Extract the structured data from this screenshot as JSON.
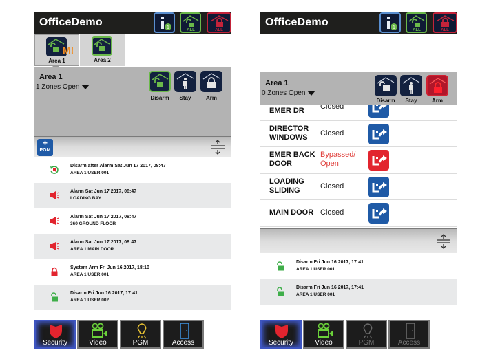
{
  "app_title": "OfficeDemo",
  "toolbar": {
    "info_badge": "1",
    "disarm_all_label": "ALL",
    "arm_all_label": "ALL"
  },
  "colors": {
    "topbar": "#1f1f1d",
    "disarm_green": "#6bb94a",
    "arm_red": "#c3233a",
    "navy": "#13213f",
    "bypass_blue": "#1f5aa6",
    "alarm_red": "#e2242e",
    "alert_orange": "#f08d24"
  },
  "left_screen": {
    "areas": [
      {
        "label": "Area 1",
        "selected": true,
        "badge": "M!"
      },
      {
        "label": "Area 2",
        "selected": false
      }
    ],
    "area_panel": {
      "name": "Area 1",
      "zones_open": "1 Zones Open",
      "modes": [
        "Disarm",
        "Stay",
        "Arm"
      ],
      "active_mode": "Disarm"
    },
    "pgm_button": {
      "plus": "+",
      "label": "PGM"
    },
    "events": [
      {
        "icon": "disarm-after-alarm-icon",
        "title": "Disarm after Alarm Sat Jun 17 2017, 08:47",
        "detail": "AREA 1 USER 001"
      },
      {
        "icon": "alarm-siren-icon",
        "title": "Alarm Sat Jun 17 2017, 08:47",
        "detail": "LOADING BAY"
      },
      {
        "icon": "alarm-siren-icon",
        "title": "Alarm Sat Jun 17 2017, 08:47",
        "detail": "360 GROUND FLOOR"
      },
      {
        "icon": "alarm-siren-icon",
        "title": "Alarm Sat Jun 17 2017, 08:47",
        "detail": "AREA 1 MAIN DOOR"
      },
      {
        "icon": "lock-closed-icon",
        "title": "System Arm Fri Jun 16 2017, 18:10",
        "detail": "AREA 1 USER 001"
      },
      {
        "icon": "lock-open-icon",
        "title": "Disarm Fri Jun 16 2017, 17:41",
        "detail": "AREA 1 USER 002"
      }
    ],
    "nav": [
      {
        "label": "Security",
        "selected": true
      },
      {
        "label": "Video",
        "selected": false
      },
      {
        "label": "PGM",
        "selected": false
      },
      {
        "label": "Access",
        "selected": false
      }
    ]
  },
  "right_screen": {
    "area_panel": {
      "name": "Area 1",
      "zones_open": "0 Zones Open",
      "modes": [
        "Disarm",
        "Stay",
        "Arm"
      ],
      "active_mode": "Arm"
    },
    "zones": [
      {
        "name": "DIRECTOR EMER DR",
        "status": "Closed",
        "state": "normal"
      },
      {
        "name": "DIRECTOR WINDOWS",
        "status": "Closed",
        "state": "normal"
      },
      {
        "name": "EMER BACK DOOR",
        "status": "Bypassed/ Open",
        "state": "bypassed"
      },
      {
        "name": "LOADING SLIDING",
        "status": "Closed",
        "state": "normal"
      },
      {
        "name": "MAIN DOOR",
        "status": "Closed",
        "state": "normal"
      }
    ],
    "events": [
      {
        "icon": "lock-open-icon",
        "title": "Disarm Fri Jun 16 2017, 17:41",
        "detail": "AREA 1 USER 001"
      },
      {
        "icon": "lock-open-icon",
        "title": "Disarm Fri Jun 16 2017, 17:41",
        "detail": "AREA 1 USER 001"
      }
    ],
    "nav": [
      {
        "label": "Security",
        "selected": true
      },
      {
        "label": "Video",
        "selected": false
      },
      {
        "label": "PGM",
        "selected": false,
        "disabled": true
      },
      {
        "label": "Access",
        "selected": false,
        "disabled": true
      }
    ]
  }
}
